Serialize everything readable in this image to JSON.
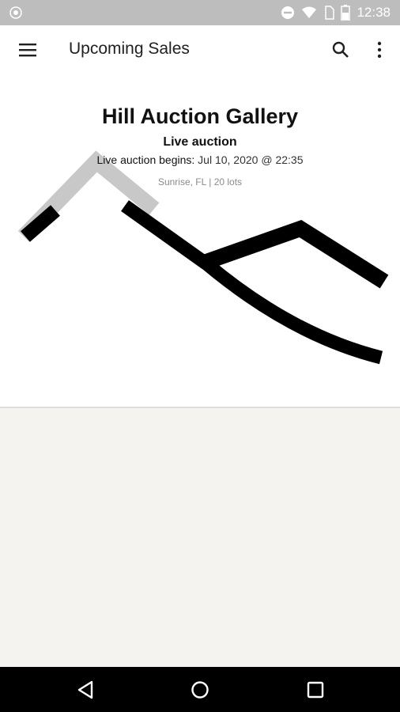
{
  "status_bar": {
    "time": "12:38",
    "icons": [
      "app-notification-icon",
      "do-not-disturb-icon",
      "wifi-icon",
      "sim-icon",
      "battery-icon"
    ]
  },
  "app_bar": {
    "title": "Upcoming Sales",
    "icons": [
      "menu-icon",
      "search-icon",
      "more-vert-icon"
    ]
  },
  "sale": {
    "gallery_name": "Hill Auction Gallery",
    "sale_type": "Live auction",
    "begins_label": "Live auction begins:",
    "begins_value": "Jul 10, 2020 @ 22:35",
    "location": "Sunrise, FL",
    "separator": "|",
    "lots": "20 lots"
  },
  "nav_bar": {
    "icons": [
      "back-icon",
      "home-icon",
      "recents-icon"
    ]
  },
  "colors": {
    "status_bar": "#bdbdbd",
    "empty_background": "#f4f3f0",
    "nav_bar": "#000000"
  }
}
